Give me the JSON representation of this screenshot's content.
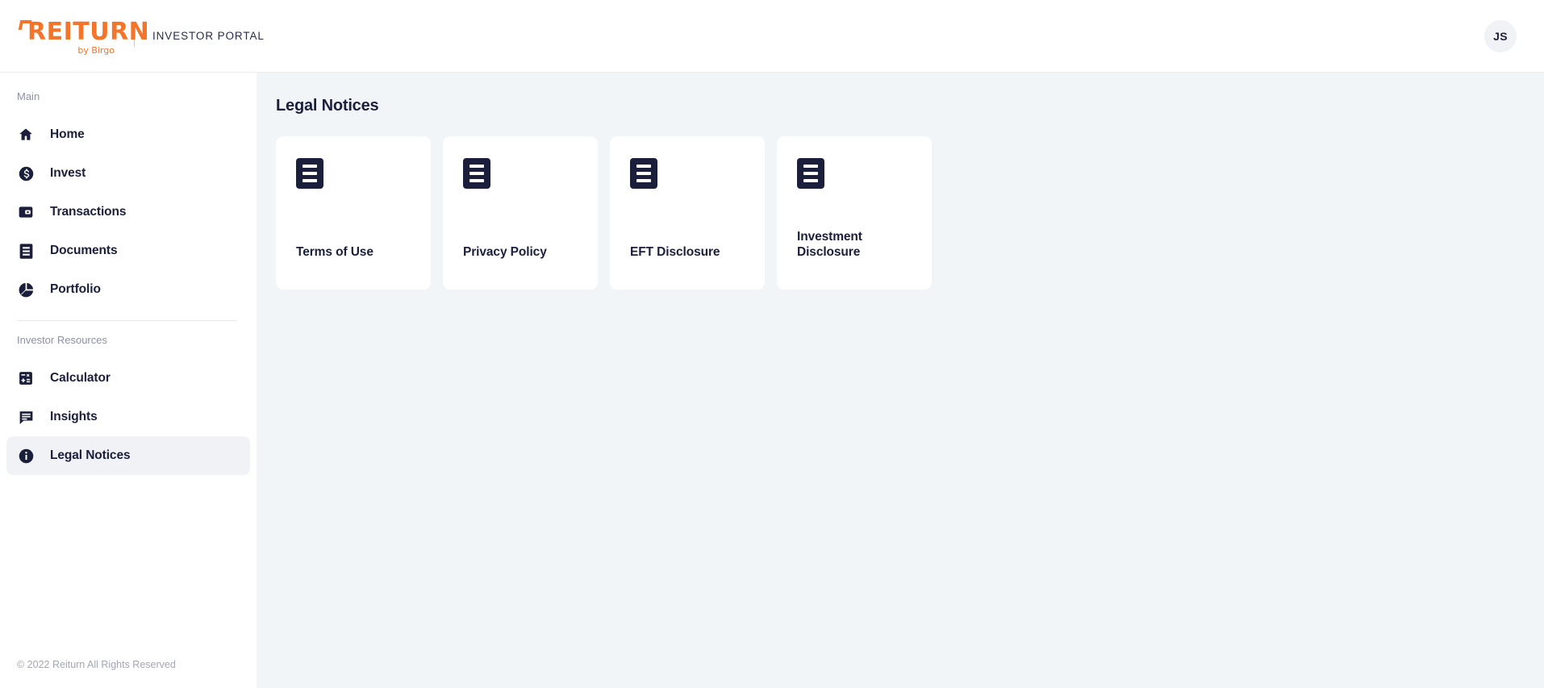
{
  "header": {
    "logo_text": "REITURN",
    "logo_tagline": "by Birgo",
    "logo_color": "#f4742a",
    "portal_label": "INVESTOR PORTAL",
    "avatar_initials": "JS"
  },
  "sidebar": {
    "sections": [
      {
        "label": "Main",
        "items": [
          {
            "label": "Home",
            "icon": "home-icon",
            "active": false
          },
          {
            "label": "Invest",
            "icon": "dollar-circle-icon",
            "active": false
          },
          {
            "label": "Transactions",
            "icon": "wallet-icon",
            "active": false
          },
          {
            "label": "Documents",
            "icon": "document-icon",
            "active": false
          },
          {
            "label": "Portfolio",
            "icon": "pie-chart-icon",
            "active": false
          }
        ]
      },
      {
        "label": "Investor Resources",
        "items": [
          {
            "label": "Calculator",
            "icon": "calculator-icon",
            "active": false
          },
          {
            "label": "Insights",
            "icon": "chat-bubble-icon",
            "active": false
          },
          {
            "label": "Legal Notices",
            "icon": "info-circle-icon",
            "active": true
          }
        ]
      }
    ],
    "footer": "© 2022 Reiturn All Rights Reserved"
  },
  "main": {
    "page_title": "Legal Notices",
    "cards": [
      {
        "title": "Terms of Use",
        "icon": "document-lines-icon"
      },
      {
        "title": "Privacy Policy",
        "icon": "document-lines-icon"
      },
      {
        "title": "EFT Disclosure",
        "icon": "document-lines-icon"
      },
      {
        "title": "Investment Disclosure",
        "icon": "document-lines-icon"
      }
    ]
  },
  "colors": {
    "brand_orange": "#f4742a",
    "navy": "#1b1f3b",
    "content_bg": "#f1f5f7",
    "active_bg": "#f1f2f5"
  }
}
